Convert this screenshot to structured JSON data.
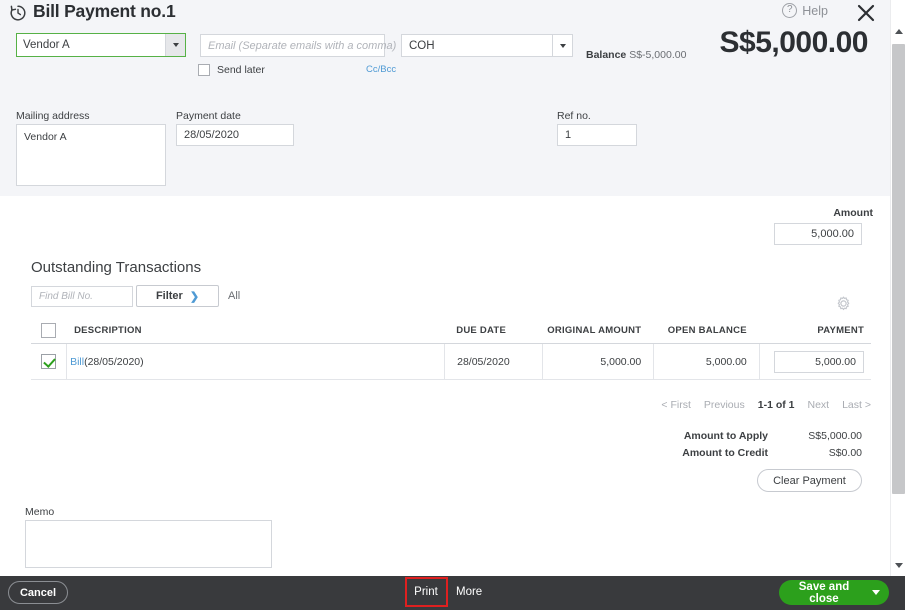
{
  "header": {
    "history_icon": "history-clock-icon",
    "title": "Bill Payment no.1",
    "help_label": "Help",
    "help_icon": "question-mark-icon",
    "close_icon": "close-x-icon",
    "vendor_value": "Vendor A",
    "email_placeholder": "Email (Separate emails with a comma)",
    "send_later_label": "Send later",
    "ccbcc_label": "Cc/Bcc",
    "account_value": "COH",
    "balance_label": "Balance",
    "balance_value": "S$-5,000.00",
    "total_amount": "S$5,000.00",
    "mailing_address_label": "Mailing address",
    "mailing_address_value": "Vendor A",
    "payment_date_label": "Payment date",
    "payment_date_value": "28/05/2020",
    "ref_no_label": "Ref no.",
    "ref_no_value": "1"
  },
  "amount_field": {
    "label": "Amount",
    "value": "5,000.00"
  },
  "outstanding": {
    "section_title": "Outstanding Transactions",
    "find_bill_placeholder": "Find Bill No.",
    "filter_label": "Filter",
    "filter_chevron": "chevron-right-icon",
    "all_label": "All",
    "settings_icon": "gear-icon",
    "columns": [
      "DESCRIPTION",
      "DUE DATE",
      "ORIGINAL AMOUNT",
      "OPEN BALANCE",
      "PAYMENT"
    ],
    "rows": [
      {
        "checked": true,
        "description_link": "Bill",
        "description_rest": " (28/05/2020)",
        "due_date": "28/05/2020",
        "original_amount": "5,000.00",
        "open_balance": "5,000.00",
        "payment": "5,000.00"
      }
    ]
  },
  "pagination": {
    "first": "< First",
    "previous": "Previous",
    "range": "1-1 of 1",
    "next": "Next",
    "last": "Last >"
  },
  "totals": {
    "amount_to_apply_label": "Amount to Apply",
    "amount_to_apply_value": "S$5,000.00",
    "amount_to_credit_label": "Amount to Credit",
    "amount_to_credit_value": "S$0.00",
    "clear_payment_label": "Clear Payment"
  },
  "memo": {
    "label": "Memo",
    "value": ""
  },
  "footer": {
    "cancel_label": "Cancel",
    "print_label": "Print",
    "more_label": "More",
    "save_label": "Save and close",
    "save_caret_icon": "chevron-down-icon"
  },
  "colors": {
    "brand_green": "#2ca01c",
    "focus_green": "#56b146",
    "link_blue": "#4f9ad4",
    "footer_dark": "#393a3d",
    "header_bg": "#f4f5f8",
    "highlight_red": "#e02020"
  },
  "scrollbar": {
    "up_icon": "scroll-up-arrow-icon",
    "down_icon": "scroll-down-arrow-icon"
  }
}
